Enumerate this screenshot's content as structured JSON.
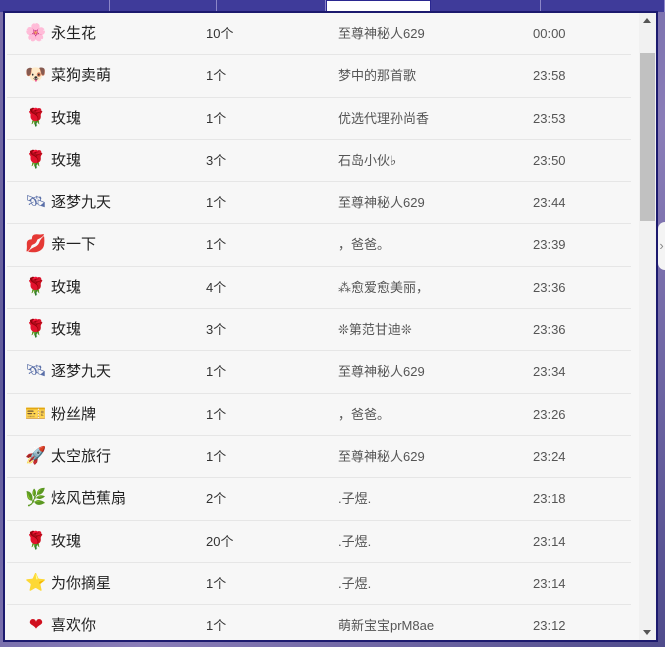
{
  "gift_list": {
    "rows": [
      {
        "icon": "flower-icon",
        "glyph": "🌸",
        "color": "#e6a0c8",
        "name": "永生花",
        "count": "10个",
        "sender": "至尊神秘人629",
        "time": "00:00"
      },
      {
        "icon": "dog-icon",
        "glyph": "🐶",
        "color": "#8a6a2a",
        "name": "菜狗卖萌",
        "count": "1个",
        "sender": "梦中的那首歌",
        "time": "23:58"
      },
      {
        "icon": "rose-icon",
        "glyph": "🌹",
        "color": "#c8102e",
        "name": "玫瑰",
        "count": "1个",
        "sender": "优选代理孙尚香",
        "time": "23:53"
      },
      {
        "icon": "rose-icon",
        "glyph": "🌹",
        "color": "#c8102e",
        "name": "玫瑰",
        "count": "3个",
        "sender": "石岛小伙♭",
        "time": "23:50"
      },
      {
        "icon": "satellite-icon",
        "glyph": "🛰",
        "color": "#5a6fa8",
        "name": "逐梦九天",
        "count": "1个",
        "sender": "至尊神秘人629",
        "time": "23:44"
      },
      {
        "icon": "lips-icon",
        "glyph": "💋",
        "color": "#b0101e",
        "name": "亲一下",
        "count": "1个",
        "sender": "，爸爸。",
        "time": "23:39"
      },
      {
        "icon": "rose-icon",
        "glyph": "🌹",
        "color": "#c8102e",
        "name": "玫瑰",
        "count": "4个",
        "sender": "⁂愈爱愈美丽，",
        "time": "23:36"
      },
      {
        "icon": "rose-icon",
        "glyph": "🌹",
        "color": "#c8102e",
        "name": "玫瑰",
        "count": "3个",
        "sender": "❊第范甘迪❊",
        "time": "23:36"
      },
      {
        "icon": "satellite-icon",
        "glyph": "🛰",
        "color": "#5a6fa8",
        "name": "逐梦九天",
        "count": "1个",
        "sender": "至尊神秘人629",
        "time": "23:34"
      },
      {
        "icon": "fan-badge-icon",
        "glyph": "🎫",
        "color": "#8a4ac8",
        "name": "粉丝牌",
        "count": "1个",
        "sender": "，爸爸。",
        "time": "23:26"
      },
      {
        "icon": "space-travel-icon",
        "glyph": "🚀",
        "color": "#e0a0b0",
        "name": "太空旅行",
        "count": "1个",
        "sender": "至尊神秘人629",
        "time": "23:24"
      },
      {
        "icon": "banana-fan-icon",
        "glyph": "🌿",
        "color": "#4a8a5a",
        "name": "炫风芭蕉扇",
        "count": "2个",
        "sender": ".子煜.",
        "time": "23:18"
      },
      {
        "icon": "rose-icon",
        "glyph": "🌹",
        "color": "#c8102e",
        "name": "玫瑰",
        "count": "20个",
        "sender": ".子煜.",
        "time": "23:14"
      },
      {
        "icon": "star-icon",
        "glyph": "⭐",
        "color": "#e8c010",
        "name": "为你摘星",
        "count": "1个",
        "sender": ".子煜.",
        "time": "23:14"
      },
      {
        "icon": "heart-icon",
        "glyph": "❤",
        "color": "#d0101e",
        "name": "喜欢你",
        "count": "1个",
        "sender": "萌新宝宝prM8ae",
        "time": "23:12"
      }
    ]
  }
}
